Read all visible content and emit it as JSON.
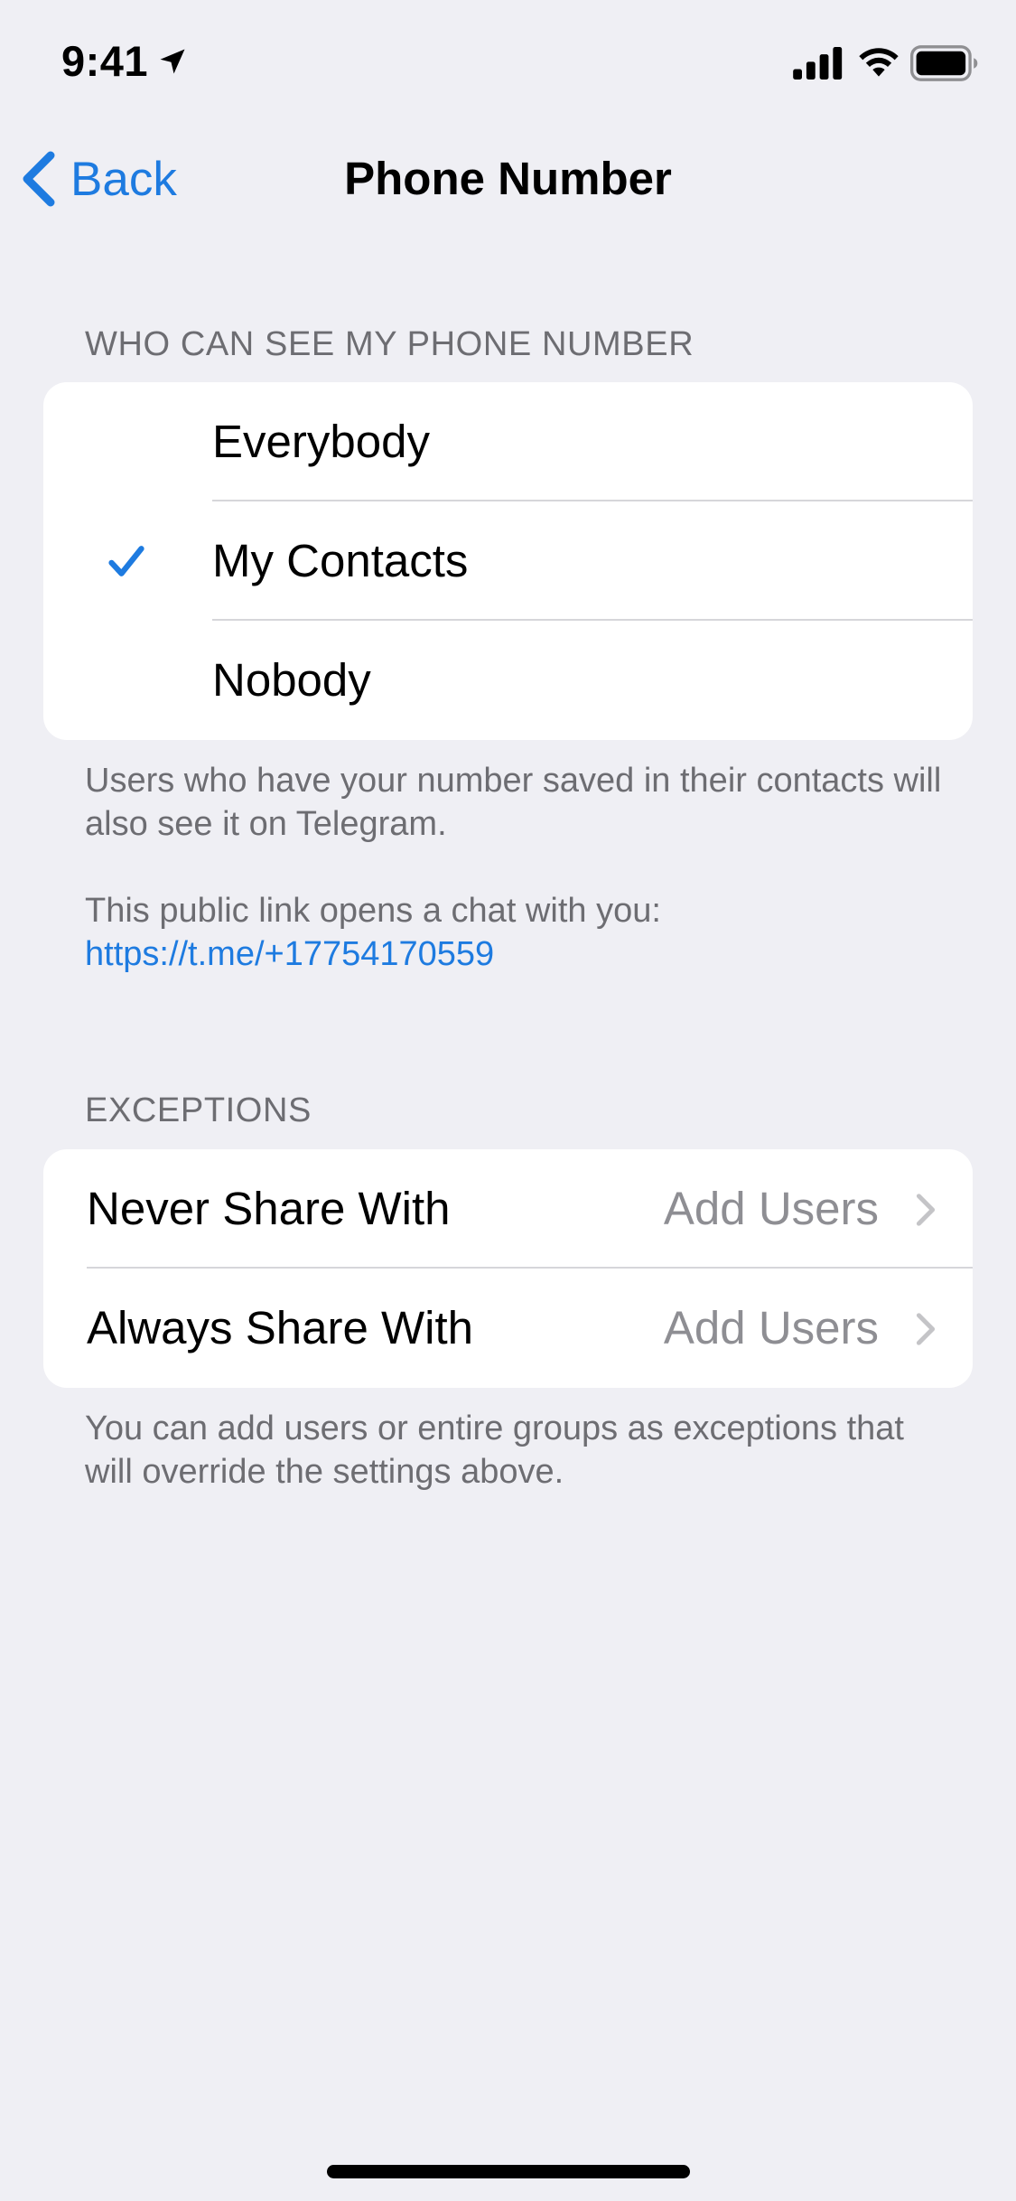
{
  "status_bar": {
    "time": "9:41",
    "icons": [
      "location-arrow-icon",
      "cellular-signal-icon",
      "wifi-icon",
      "battery-icon"
    ]
  },
  "nav": {
    "back_label": "Back",
    "title": "Phone Number"
  },
  "visibility_section": {
    "header": "WHO CAN SEE MY PHONE NUMBER",
    "options": [
      {
        "label": "Everybody",
        "selected": false
      },
      {
        "label": "My Contacts",
        "selected": true
      },
      {
        "label": "Nobody",
        "selected": false
      }
    ],
    "footer_note": "Users who have your number saved in their contacts will also see it on Telegram.",
    "link_intro": "This public link opens a chat with you:",
    "link_url": "https://t.me/+17754170559"
  },
  "exceptions_section": {
    "header": "EXCEPTIONS",
    "rows": [
      {
        "label": "Never Share With",
        "value": "Add Users"
      },
      {
        "label": "Always Share With",
        "value": "Add Users"
      }
    ],
    "footer_note": "You can add users or entire groups as exceptions that will override the settings above."
  },
  "colors": {
    "accent": "#1E7BE0",
    "background": "#EFEFF4",
    "secondary_text": "#6D6D72",
    "value_text": "#8E8E93"
  }
}
